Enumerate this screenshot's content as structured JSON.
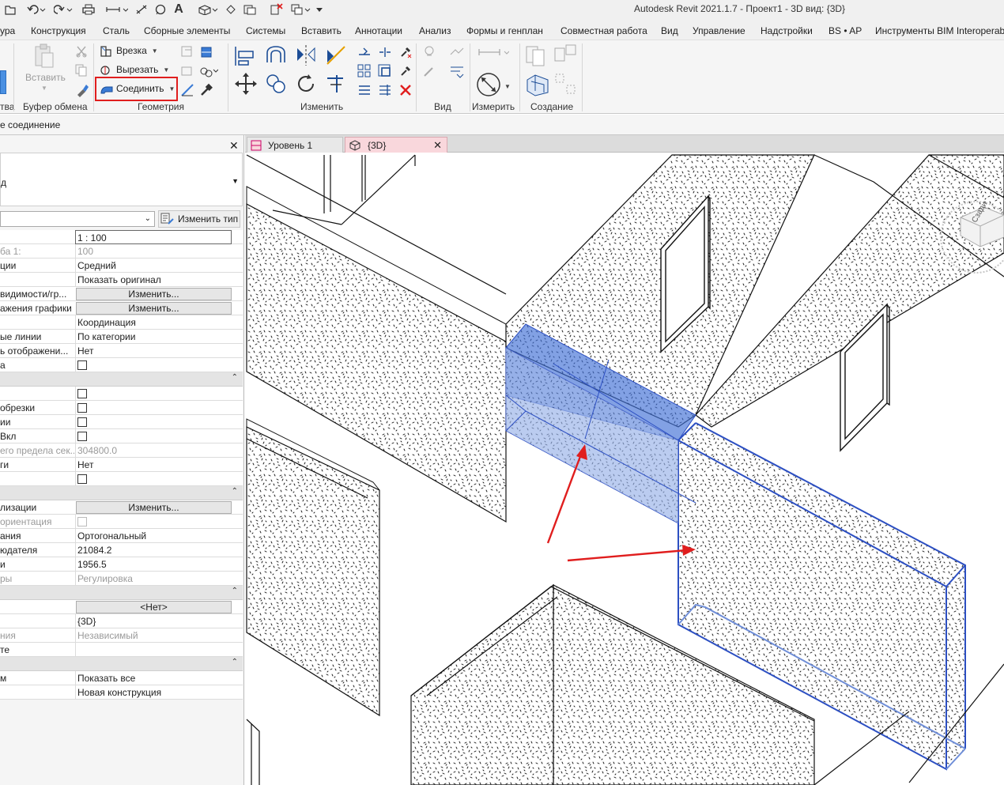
{
  "app_title": "Autodesk Revit 2021.1.7 - Проект1 - 3D вид: {3D}",
  "ribbon_tabs": [
    "ура",
    "Конструкция",
    "Сталь",
    "Сборные элементы",
    "Системы",
    "Вставить",
    "Аннотации",
    "Анализ",
    "Формы и генплан",
    "Совместная работа",
    "Вид",
    "Управление",
    "Надстройки",
    "BS • AP",
    "Инструменты BIM Interoperab"
  ],
  "ribbon": {
    "paste_label": "Вставить",
    "cut_geom_label": "Врезка",
    "cut_label": "Вырезать",
    "join_label": "Соединить",
    "groups": {
      "left_partial": "тва",
      "clipboard": "Буфер обмена",
      "geometry": "Геометрия",
      "modify": "Изменить",
      "view": "Вид",
      "measure": "Измерить",
      "create": "Создание"
    }
  },
  "options_bar": {
    "text": "е соединение"
  },
  "properties": {
    "type_selector_partial": "д",
    "edit_type_label": "Изменить тип",
    "rows": [
      {
        "key": "",
        "value": "1 : 100",
        "kind": "input"
      },
      {
        "key": "ба    1:",
        "value": "100",
        "kind": "gray"
      },
      {
        "key": "ции",
        "value": "Средний",
        "kind": "text"
      },
      {
        "key": "",
        "value": "Показать оригинал",
        "kind": "text"
      },
      {
        "key": " видимости/гр...",
        "value": "Изменить...",
        "kind": "button"
      },
      {
        "key": "ажения графики",
        "value": "Изменить...",
        "kind": "button"
      },
      {
        "key": "",
        "value": "Координация",
        "kind": "text"
      },
      {
        "key": "ые линии",
        "value": "По категории",
        "kind": "text"
      },
      {
        "key": "ь отображени...",
        "value": "Нет",
        "kind": "text"
      },
      {
        "key": "а",
        "value": "",
        "kind": "check"
      },
      {
        "key": "",
        "value": "",
        "kind": "header"
      },
      {
        "key": "",
        "value": "",
        "kind": "check"
      },
      {
        "key": "обрезки",
        "value": "",
        "kind": "check"
      },
      {
        "key": "ии",
        "value": "",
        "kind": "check"
      },
      {
        "key": "Вкл",
        "value": "",
        "kind": "check"
      },
      {
        "key": "его предела сек...",
        "value": "304800.0",
        "kind": "gray"
      },
      {
        "key": "ги",
        "value": "Нет",
        "kind": "text"
      },
      {
        "key": "",
        "value": "",
        "kind": "check"
      },
      {
        "key": "",
        "value": "",
        "kind": "header"
      },
      {
        "key": "лизации",
        "value": "Изменить...",
        "kind": "button"
      },
      {
        "key": " ориентация",
        "value": "",
        "kind": "checkdis"
      },
      {
        "key": "ания",
        "value": "Ортогональный",
        "kind": "text"
      },
      {
        "key": "юдателя",
        "value": "21084.2",
        "kind": "text"
      },
      {
        "key": "и",
        "value": "1956.5",
        "kind": "text"
      },
      {
        "key": "ры",
        "value": "Регулировка",
        "kind": "gray"
      },
      {
        "key": "",
        "value": "",
        "kind": "header"
      },
      {
        "key": "",
        "value": "<Нет>",
        "kind": "button"
      },
      {
        "key": "",
        "value": "{3D}",
        "kind": "text"
      },
      {
        "key": "ния",
        "value": "Независимый",
        "kind": "gray"
      },
      {
        "key": "те",
        "value": "",
        "kind": "text"
      },
      {
        "key": "",
        "value": "",
        "kind": "header"
      },
      {
        "key": "м",
        "value": "Показать все",
        "kind": "text"
      },
      {
        "key": "",
        "value": "Новая конструкция",
        "kind": "text"
      }
    ]
  },
  "view_tabs": [
    {
      "label": "Уровень 1",
      "active": false
    },
    {
      "label": "{3D}",
      "active": true
    }
  ],
  "viewcube_label": "Сзади",
  "colors": {
    "selection_fill": "#3f6fd6",
    "selection_edge": "#2c4fc2",
    "annotation_red": "#e01e1e",
    "active_tab": "#f9d7dc"
  }
}
